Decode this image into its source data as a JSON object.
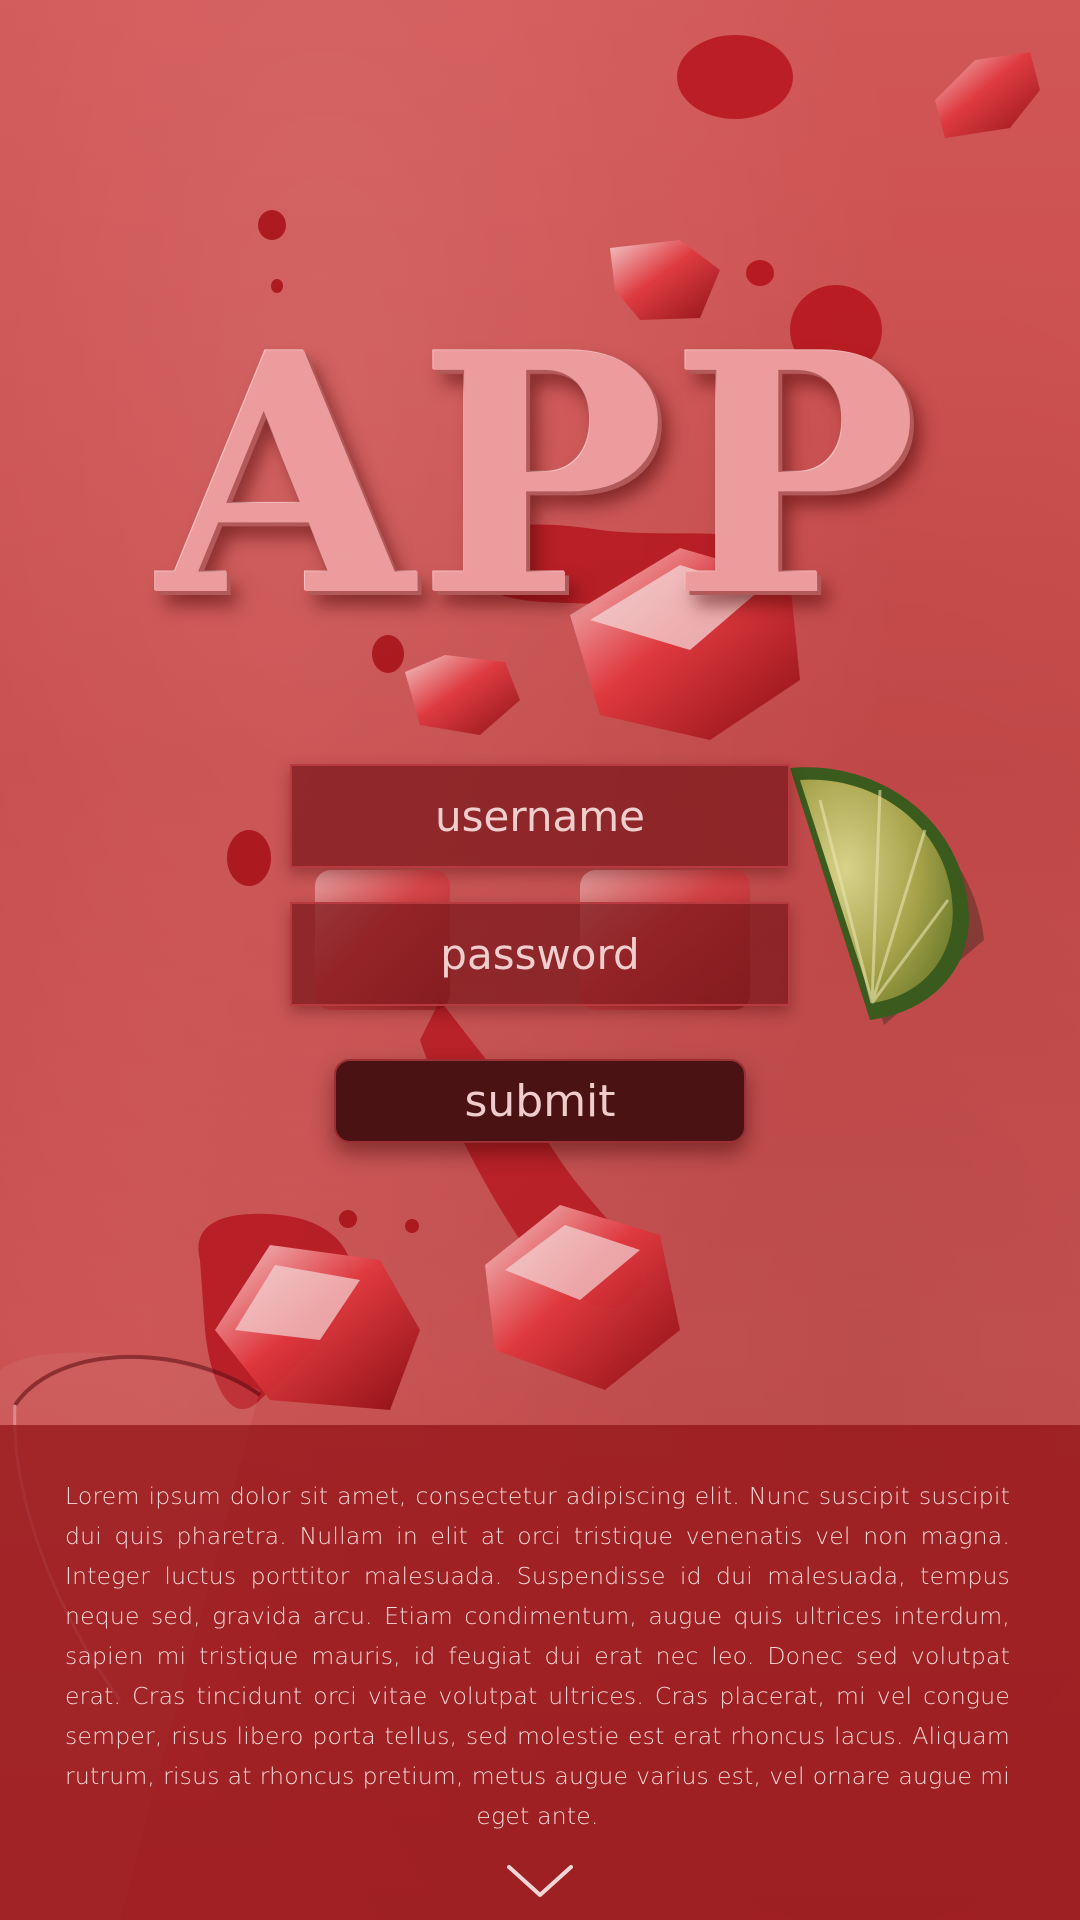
{
  "app": {
    "title": "APP"
  },
  "login": {
    "username_placeholder": "username",
    "password_placeholder": "password",
    "submit_label": "submit"
  },
  "footer": {
    "text": "Lorem ipsum dolor sit amet, consectetur adipiscing elit. Nunc suscipit suscipit dui quis pharetra. Nullam in elit at orci tristique venenatis vel non magna. Integer luctus porttitor malesuada. Suspendisse id dui malesuada, tempus neque sed, gravida arcu. Etiam condimentum, augue quis ultrices interdum, sapien mi tristique mauris, id feugiat dui erat nec leo. Donec sed volutpat erat. Cras tincidunt orci vitae volutpat ultrices. Cras placerat, mi vel congue semper, risus libero porta tellus, sed molestie est erat rhoncus lacus. Aliquam rutrum, risus at rhoncus pretium, metus augue varius est, vel ornare augue mi eget ante.",
    "scroll_icon": "chevron-down-icon"
  },
  "colors": {
    "background": "#c94a4a",
    "title": "#ec9c9c",
    "field_bg": "#78161a",
    "submit_bg": "#4a1212",
    "panel_bg": "#96161a",
    "text_light": "#f4d8d8"
  }
}
